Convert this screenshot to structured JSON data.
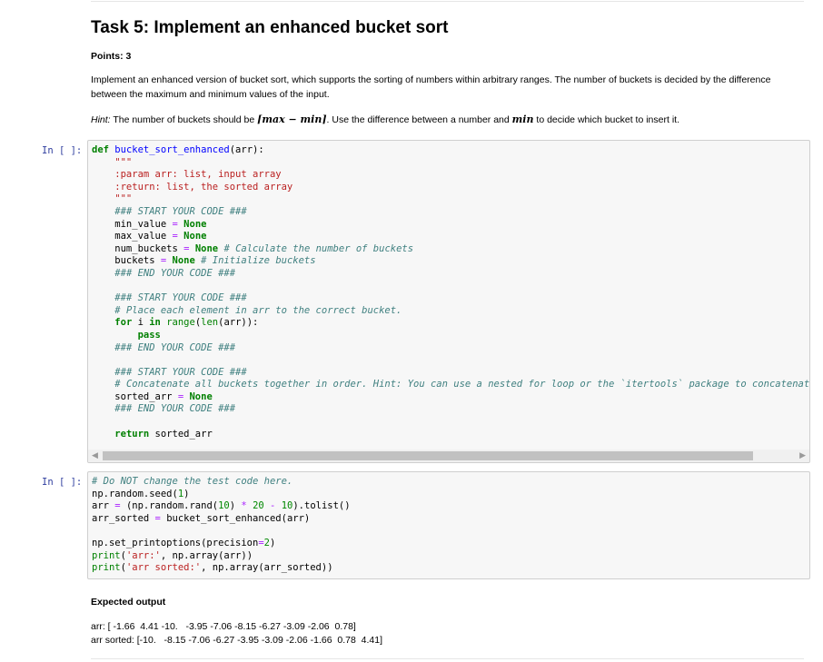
{
  "task": {
    "title": "Task 5: Implement an enhanced bucket sort",
    "points": "Points: 3",
    "description": "Implement an enhanced version of bucket sort, which supports the sorting of numbers within arbitrary ranges. The number of buckets is decided by the difference between the maximum and minimum values of the input.",
    "hint_label": "Hint:",
    "hint_text_1": "The number of buckets should be",
    "hint_formula": "⌈max − min⌉",
    "hint_text_2": ". Use the difference between a number and",
    "hint_min": "min",
    "hint_text_3": "to decide which bucket to insert it."
  },
  "cell1": {
    "prompt": "In [ ]:",
    "lines": [
      "def bucket_sort_enhanced(arr):",
      "    \"\"\"",
      "    :param arr: list, input array",
      "    :return: list, the sorted array",
      "    \"\"\"",
      "    ### START YOUR CODE ###",
      "    min_value = None",
      "    max_value = None",
      "    num_buckets = None # Calculate the number of buckets",
      "    buckets = None # Initialize buckets",
      "    ### END YOUR CODE ###",
      "",
      "    ### START YOUR CODE ###",
      "    # Place each element in arr to the correct bucket.",
      "    for i in range(len(arr)):",
      "        pass",
      "    ### END YOUR CODE ###",
      "",
      "    ### START YOUR CODE ###",
      "    # Concatenate all buckets together in order. Hint: You can use a nested for loop or the `itertools` package to concatenate bu",
      "    sorted_arr = None",
      "    ### END YOUR CODE ###",
      "",
      "    return sorted_arr"
    ]
  },
  "cell2": {
    "prompt": "In [ ]:",
    "lines": [
      "# Do NOT change the test code here.",
      "np.random.seed(1)",
      "arr = (np.random.rand(10) * 20 - 10).tolist()",
      "arr_sorted = bucket_sort_enhanced(arr)",
      "",
      "np.set_printoptions(precision=2)",
      "print('arr:', np.array(arr))",
      "print('arr sorted:', np.array(arr_sorted))"
    ]
  },
  "expected": {
    "heading": "Expected output",
    "line1": "arr: [ -1.66  4.41 -10.   -3.95 -7.06 -8.15 -6.27 -3.09 -2.06  0.78]",
    "line2": "arr sorted: [-10.   -8.15 -7.06 -6.27 -3.95 -3.09 -2.06 -1.66  0.78  4.41]"
  },
  "icons": {
    "scroll_left": "triangle-left",
    "scroll_right": "triangle-right"
  }
}
